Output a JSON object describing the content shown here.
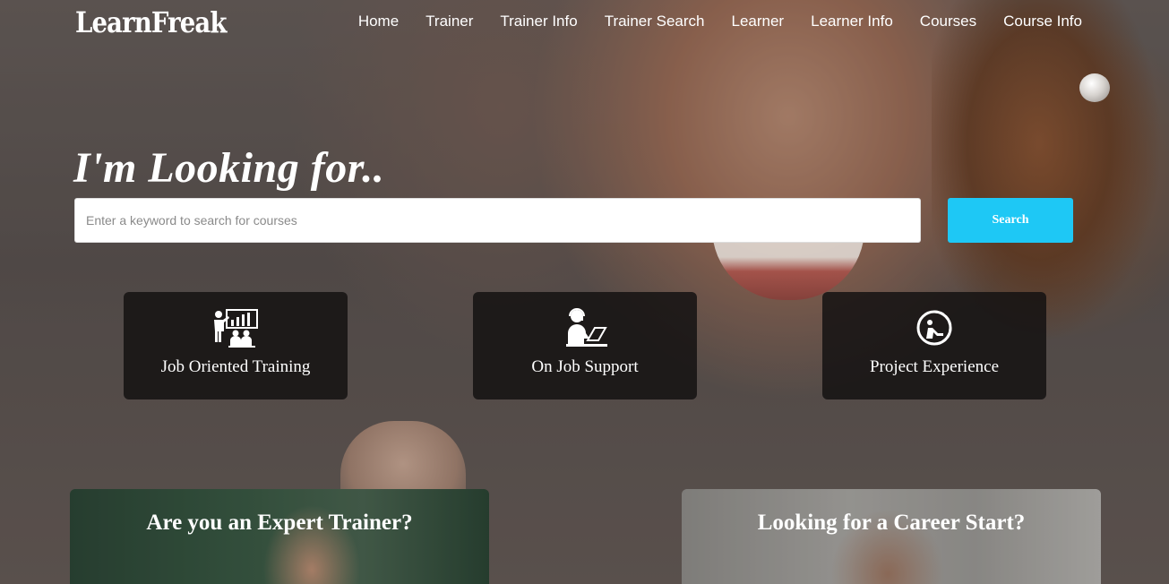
{
  "brand": "LearnFreak",
  "nav": [
    {
      "label": "Home"
    },
    {
      "label": "Trainer"
    },
    {
      "label": "Trainer Info"
    },
    {
      "label": "Trainer Search"
    },
    {
      "label": "Learner"
    },
    {
      "label": "Learner Info"
    },
    {
      "label": "Courses"
    },
    {
      "label": "Course Info"
    }
  ],
  "hero": {
    "headline": "I'm Looking for..",
    "search_placeholder": "Enter a keyword to search for courses",
    "search_button": "Search"
  },
  "features": [
    {
      "label": "Job Oriented Training",
      "icon": "presentation-icon"
    },
    {
      "label": "On Job Support",
      "icon": "laptop-support-icon"
    },
    {
      "label": "Project Experience",
      "icon": "project-clock-icon"
    }
  ],
  "promos": [
    {
      "title": "Are you an Expert Trainer?"
    },
    {
      "title": "Looking for a Career Start?"
    }
  ],
  "colors": {
    "accent": "#1ec8f5",
    "card_bg": "#141212"
  }
}
